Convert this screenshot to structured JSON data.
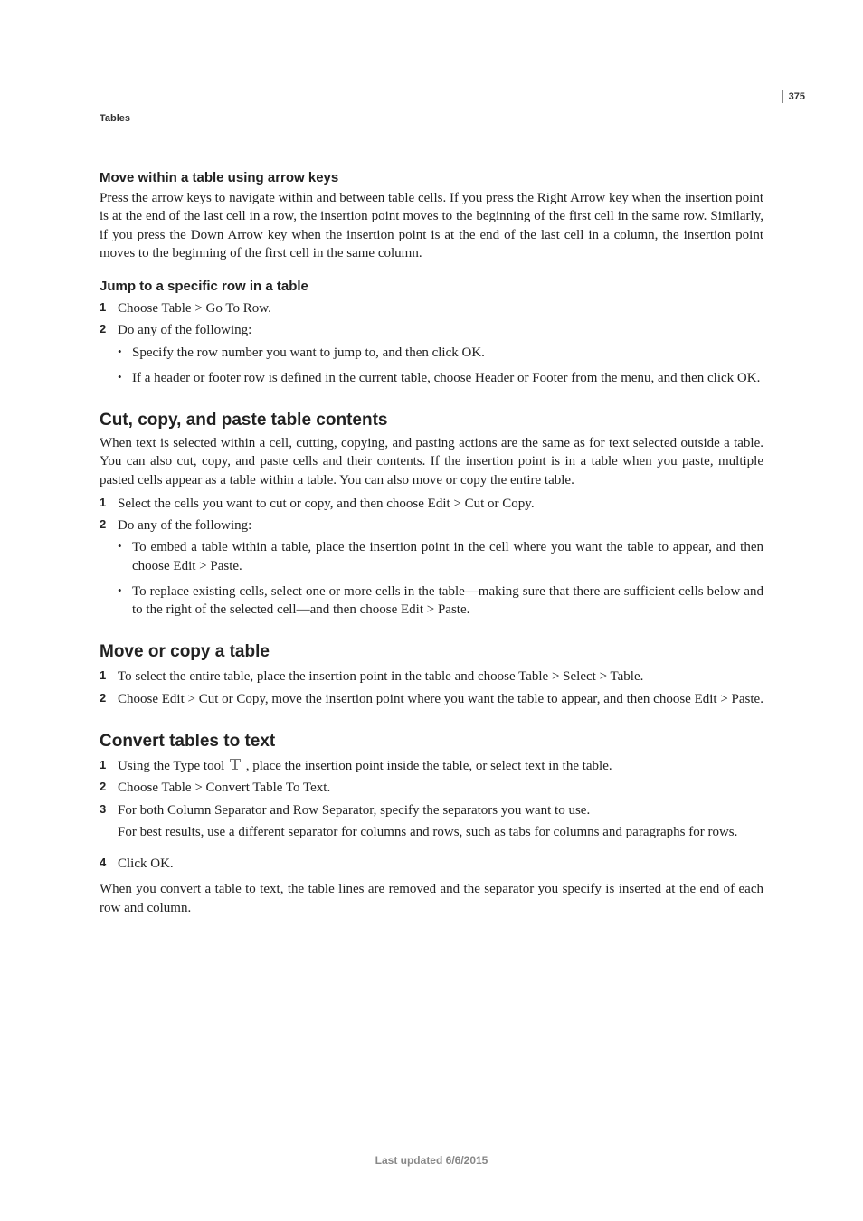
{
  "page_number": "375",
  "section_label": "Tables",
  "footer": "Last updated 6/6/2015",
  "move_arrow": {
    "heading": "Move within a table using arrow keys",
    "body": "Press the arrow keys to navigate within and between table cells. If you press the Right Arrow key when the insertion point is at the end of the last cell in a row, the insertion point moves to the beginning of the first cell in the same row. Similarly, if you press the Down Arrow key when the insertion point is at the end of the last cell in a column, the insertion point moves to the beginning of the first cell in the same column."
  },
  "jump_row": {
    "heading": "Jump to a specific row in a table",
    "step1": "Choose Table > Go To Row.",
    "step2": "Do any of the following:",
    "bullet1": "Specify the row number you want to jump to, and then click OK.",
    "bullet2": "If a header or footer row is defined in the current table, choose Header or Footer from the menu, and then click OK."
  },
  "cut_copy": {
    "heading": "Cut, copy, and paste table contents",
    "body": "When text is selected within a cell, cutting, copying, and pasting actions are the same as for text selected outside a table. You can also cut, copy, and paste cells and their contents. If the insertion point is in a table when you paste, multiple pasted cells appear as a table within a table. You can also move or copy the entire table.",
    "step1": "Select the cells you want to cut or copy, and then choose Edit > Cut or Copy.",
    "step2": "Do any of the following:",
    "bullet1": "To embed a table within a table, place the insertion point in the cell where you want the table to appear, and then choose Edit > Paste.",
    "bullet2": "To replace existing cells, select one or more cells in the table—making sure that there are sufficient cells below and to the right of the selected cell—and then choose Edit > Paste."
  },
  "move_copy_table": {
    "heading": "Move or copy a table",
    "step1": "To select the entire table, place the insertion point in the table and choose Table > Select > Table.",
    "step2": "Choose Edit > Cut or Copy, move the insertion point where you want the table to appear, and then choose Edit > Paste."
  },
  "convert": {
    "heading": "Convert tables to text",
    "step1_pre": "Using the Type tool ",
    "step1_post": " , place the insertion point inside the table, or select text in the table.",
    "step2": "Choose Table > Convert Table To Text.",
    "step3": "For both Column Separator and Row Separator, specify the separators you want to use.",
    "step3_note": "For best results, use a different separator for columns and rows, such as tabs for columns and paragraphs for rows.",
    "step4": "Click OK.",
    "closing": "When you convert a table to text, the table lines are removed and the separator you specify is inserted at the end of each row and column."
  },
  "nums": {
    "n1": "1",
    "n2": "2",
    "n3": "3",
    "n4": "4"
  }
}
